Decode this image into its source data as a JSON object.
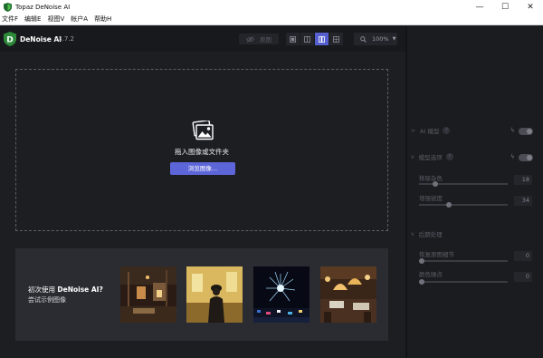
{
  "window": {
    "title": "Topaz DeNoise AI",
    "minimize_glyph": "—",
    "maximize_glyph": "☐",
    "close_glyph": "✕"
  },
  "menu": [
    "文件F",
    "编辑E",
    "视图V",
    "帐户A",
    "帮助H"
  ],
  "appbar": {
    "brand_name": "DeNoise AI",
    "version": "v3.7.2",
    "preview_label": "原图",
    "view_modes": [
      "single-view",
      "split-view",
      "side-by-side-view",
      "grid-view"
    ],
    "active_view": "side-by-side-view",
    "zoom": "100%",
    "accent": "#555fd0"
  },
  "dropzone": {
    "text": "拖入图像或文件夹",
    "browse_label": "浏览图像..."
  },
  "samples": {
    "question_prefix": "初次使用 ",
    "question_brand": "DeNoise AI?",
    "subtext": "尝试示例图像",
    "thumbnails": [
      "interior-market-photo",
      "person-in-archway-photo",
      "fireworks-night-photo",
      "restaurant-lanterns-photo"
    ]
  },
  "panel": {
    "ai_model": {
      "title": "AI 模型",
      "help": "?",
      "enabled": true
    },
    "model_options": {
      "title": "模型选项",
      "help": "?",
      "enabled": true,
      "params": [
        {
          "label": "移除杂色",
          "value": "18",
          "fraction": 0.18
        },
        {
          "label": "增强锐度",
          "value": "34",
          "fraction": 0.34
        }
      ]
    },
    "post_processing": {
      "title": "后期处理",
      "params": [
        {
          "label": "恢复原图细节",
          "value": "0",
          "fraction": 0.0
        },
        {
          "label": "颜色噪点",
          "value": "0",
          "fraction": 0.0
        }
      ]
    }
  }
}
